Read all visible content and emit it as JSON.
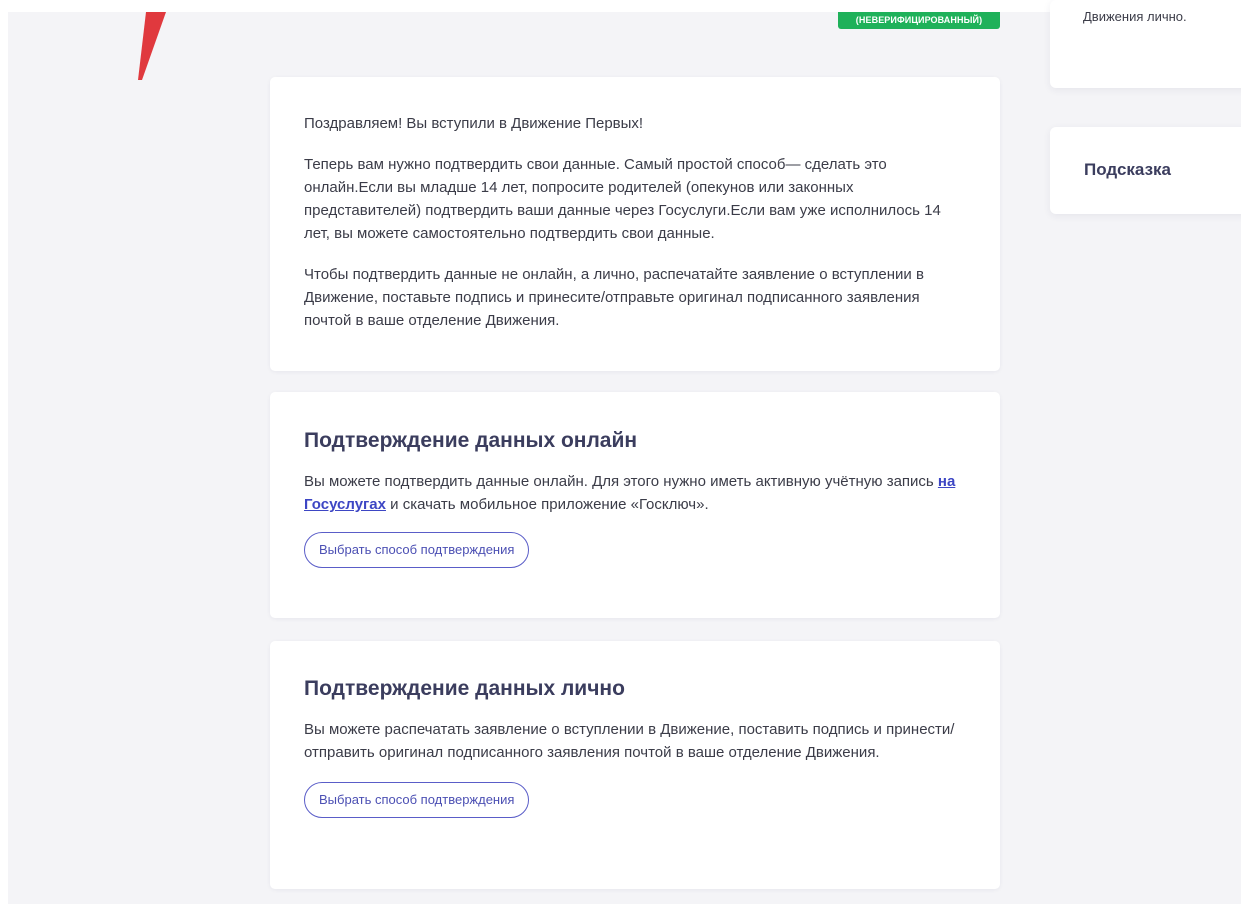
{
  "status_badge": "(НЕВЕРИФИЦИРОВАННЫЙ)",
  "side_panel": {
    "top_text": "Движения лично.",
    "hint_title": "Подсказка"
  },
  "congrats_card": {
    "paragraphs": [
      "Поздравляем! Вы вступили в Движение Первых!",
      "Теперь вам нужно подтвердить свои данные. Самый простой способ— сделать это онлайн.Если вы младше 14 лет, попросите родителей (опекунов или законных представителей) подтвердить ваши данные через Госуслуги.Если вам уже исполнилось 14 лет, вы можете самостоятельно подтвердить свои данные.",
      "Чтобы подтвердить данные не онлайн, а лично, распечатайте заявление о вступлении в Движение, поставьте подпись и принесите/отправьте оригинал подписанного заявления почтой в ваше отделение Движения."
    ]
  },
  "online_card": {
    "title": "Подтверждение данных онлайн",
    "text_before_link": "Вы можете подтвердить данные онлайн. Для этого нужно иметь активную учётную запись ",
    "link_text": "на Госуслугах",
    "text_after_link": " и скачать мобильное приложение «Госключ».",
    "button_label": "Выбрать способ подтверждения"
  },
  "personal_card": {
    "title": "Подтверждение данных лично",
    "text": "Вы можете распечатать заявление о вступлении в Движение, поставить подпись и принести/отправить оригинал подписанного заявления почтой в ваше отделение Движения.",
    "button_label": "Выбрать способ подтверждения"
  },
  "colors": {
    "accent_red": "#e0393e",
    "badge_green": "#1fb15a",
    "button_border": "#5a5dc8",
    "link": "#3d46c4",
    "heading": "#3b3d5e"
  }
}
